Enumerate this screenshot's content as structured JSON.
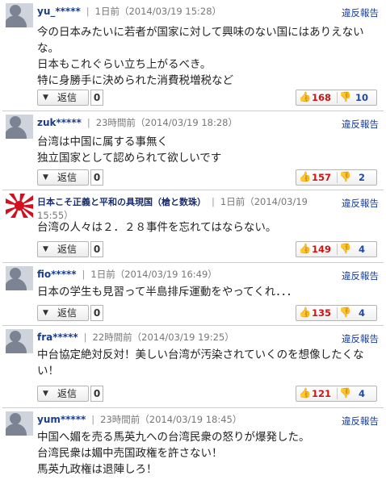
{
  "report_label": "違反報告",
  "reply_label": "返信",
  "comments": [
    {
      "user": "yu_*****",
      "time": "1日前（2014/03/19 15:28）",
      "text": "今の日本みたいに若者が国家に対して興味のない国にはありえないな。\n日本もこれぐらい立ち上がるべき。\n特に身勝手に決められた消費税増税など",
      "replies": "0",
      "up": "168",
      "down": "10"
    },
    {
      "user": "zuk*****",
      "time": "23時間前（2014/03/19 18:28）",
      "text": "台湾は中国に属する事無く\n独立国家として認められて欲しいです",
      "replies": "0",
      "up": "157",
      "down": "2"
    },
    {
      "user": "日本こそ正義と平和の具現国（槍と数珠）",
      "time": "1日前（2014/03/19 15:55）",
      "text": "台湾の人々は２．２８事件を忘れてはならない。",
      "replies": "0",
      "up": "149",
      "down": "4"
    },
    {
      "user": "fio*****",
      "time": "1日前（2014/03/19 16:49）",
      "text": "日本の学生も見習って半島排斥運動をやってくれ．．．",
      "replies": "0",
      "up": "135",
      "down": "4"
    },
    {
      "user": "fra*****",
      "time": "22時間前（2014/03/19 19:25）",
      "text": "中台協定絶対反対！美しい台湾が汚染されていくのを想像したくない！",
      "replies": "0",
      "up": "121",
      "down": "4"
    },
    {
      "user": "yum*****",
      "time": "23時間前（2014/03/19 18:45）",
      "text": "中国へ媚を売る馬英九への台湾民衆の怒りが爆発した。\n台湾民衆は媚中売国政権を許さない！\n馬英九政権は退陣しろ！"
    }
  ]
}
